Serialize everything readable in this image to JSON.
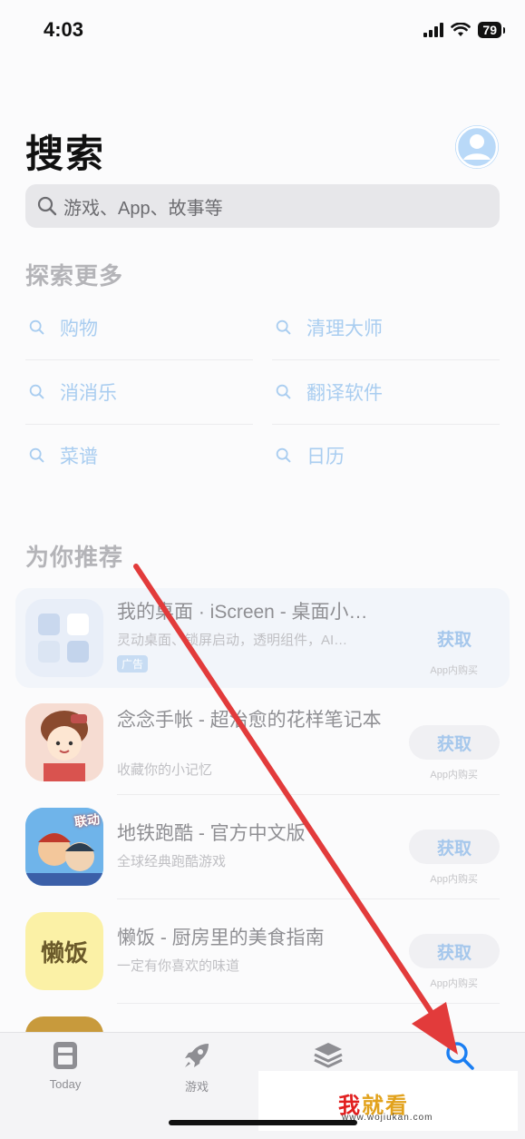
{
  "status_bar": {
    "time": "4:03",
    "battery": "79"
  },
  "header": {
    "title": "搜索"
  },
  "search": {
    "placeholder": "游戏、App、故事等"
  },
  "explore": {
    "title": "探索更多",
    "items": [
      "购物",
      "清理大师",
      "消消乐",
      "翻译软件",
      "菜谱",
      "日历"
    ]
  },
  "recommend": {
    "title": "为你推荐",
    "apps": [
      {
        "name": "我的桌面 · iScreen - 桌面小…",
        "subtitle": "灵动桌面、锁屏启动，透明组件，AI…",
        "badge": "广告",
        "button": "获取",
        "iap": "App内购买"
      },
      {
        "name": "念念手帐 - 超治愈的花样笔记本",
        "subtitle": "收藏你的小记忆",
        "button": "获取",
        "iap": "App内购买"
      },
      {
        "name": "地铁跑酷 - 官方中文版",
        "subtitle": "全球经典跑酷游戏",
        "button": "获取",
        "iap": "App内购买"
      },
      {
        "name": "懒饭 - 厨房里的美食指南",
        "subtitle": "一定有你喜欢的味道",
        "button": "获取",
        "iap": "App内购买",
        "icon_text": "懒饭"
      }
    ]
  },
  "icon_texts": {
    "subway_badge": "联动"
  },
  "tabbar": {
    "items": [
      {
        "label": "Today",
        "icon": "today-icon"
      },
      {
        "label": "游戏",
        "icon": "rocket-icon"
      },
      {
        "label": "",
        "icon": "apps-stack-icon"
      },
      {
        "label": "",
        "icon": "search-icon",
        "active": true
      }
    ]
  },
  "watermark": {
    "brand": "我就看",
    "brand_first": "我",
    "brand_rest": "就看",
    "url": "www.wojiukan.com"
  },
  "colors": {
    "accent": "#1a7ef2",
    "arrow": "#e23b3b",
    "link": "#a9cdf0"
  }
}
